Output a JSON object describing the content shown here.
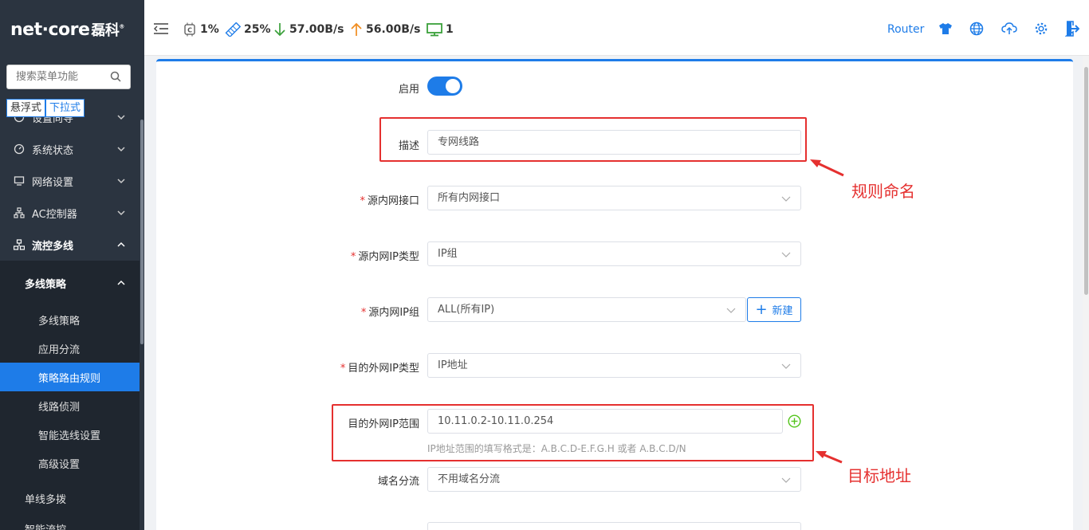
{
  "brand": {
    "logo_text": "net·core",
    "logo_cn": "磊科",
    "logo_mark": "®"
  },
  "sidebar": {
    "search_placeholder": "搜索菜单功能",
    "mode_toggle": [
      "悬浮式",
      "下拉式"
    ],
    "hidden_item": "设置向导",
    "items": [
      {
        "label": "系统状态",
        "icon": "dashboard-icon"
      },
      {
        "label": "网络设置",
        "icon": "monitor-icon"
      },
      {
        "label": "AC控制器",
        "icon": "sitemap-icon"
      },
      {
        "label": "流控多线",
        "icon": "network-icon"
      }
    ],
    "group": "多线策略",
    "sub_items": [
      "多线策略",
      "应用分流",
      "策略路由规则",
      "线路侦测",
      "智能选线设置",
      "高级设置"
    ],
    "active_sub": "策略路由规则",
    "more_items": [
      "单线多拨",
      "智能流控"
    ]
  },
  "topbar": {
    "cpu": "1%",
    "memory": "25%",
    "download": "57.00B/s",
    "upload": "56.00B/s",
    "devices": "1",
    "router_label": "Router"
  },
  "form": {
    "enable_label": "启用",
    "enabled": true,
    "desc_label": "描述",
    "desc_value": "专网线路",
    "src_iface_label": "源内网接口",
    "src_iface_value": "所有内网接口",
    "src_ip_type_label": "源内网IP类型",
    "src_ip_type_value": "IP组",
    "src_ip_group_label": "源内网IP组",
    "src_ip_group_value": "ALL(所有IP)",
    "new_button": "新建",
    "dst_ip_type_label": "目的外网IP类型",
    "dst_ip_type_value": "IP地址",
    "dst_ip_range_label": "目的外网IP范围",
    "dst_ip_range_value": "10.11.0.2-10.11.0.254",
    "dst_ip_hint": "IP地址范围的填写格式是：A.B.C.D-E.F.G.H 或者 A.B.C.D/N",
    "domain_label": "域名分流",
    "domain_value": "不用域名分流"
  },
  "annotations": {
    "rule_name": "规则命名",
    "target_addr": "目标地址"
  },
  "colors": {
    "accent": "#1e7ce8",
    "sidebar_bg": "#2b3440",
    "annotation": "#e5302f"
  }
}
